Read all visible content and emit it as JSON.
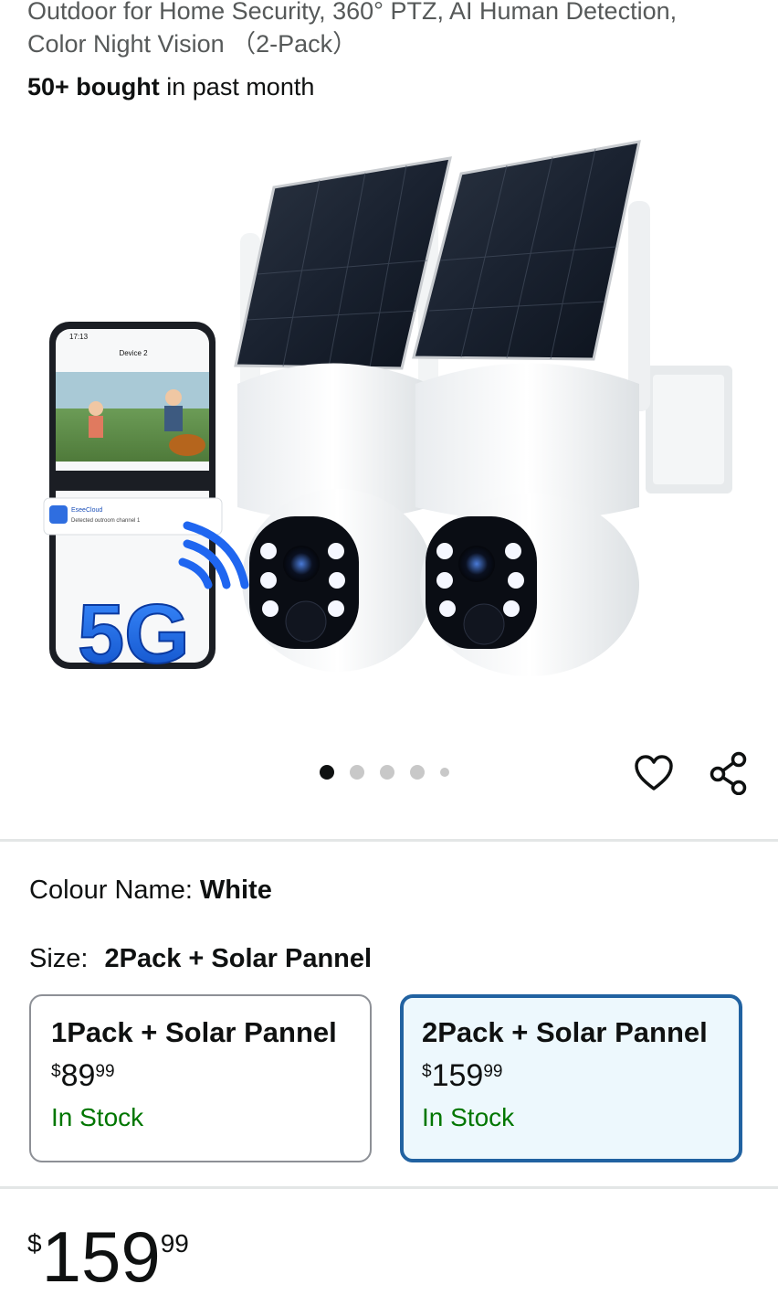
{
  "product": {
    "title_line1": "Outdoor for Home Security, 360° PTZ, AI Human Detection,",
    "title_line2": "Color Night Vision （2-Pack）",
    "bought_count": "50+ bought",
    "bought_suffix": " in past month"
  },
  "gallery": {
    "image_label_5g": "5G",
    "phone_app_title": "Device 2",
    "phone_time": "17:13",
    "notification_app": "EseeCloud",
    "notification_text": "Detected outroom channel 1",
    "dots": {
      "count": 5,
      "active_index": 0
    },
    "wishlist_icon": "heart-icon",
    "share_icon": "share-icon"
  },
  "variations": {
    "colour_label": "Colour Name:",
    "colour_value": "White",
    "size_label": "Size:",
    "size_value": "2Pack + Solar Pannel",
    "options": [
      {
        "name": "1Pack + Solar Pannel",
        "price_symbol": "$",
        "price_whole": "89",
        "price_cents": "99",
        "stock": "In Stock",
        "selected": false
      },
      {
        "name": "2Pack + Solar Pannel",
        "price_symbol": "$",
        "price_whole": "159",
        "price_cents": "99",
        "stock": "In Stock",
        "selected": true
      }
    ]
  },
  "price": {
    "symbol": "$",
    "whole": "159",
    "cents": "99"
  },
  "colors": {
    "selected_border": "#2162a1",
    "selected_bg": "#edf8fd",
    "in_stock": "#007600"
  }
}
